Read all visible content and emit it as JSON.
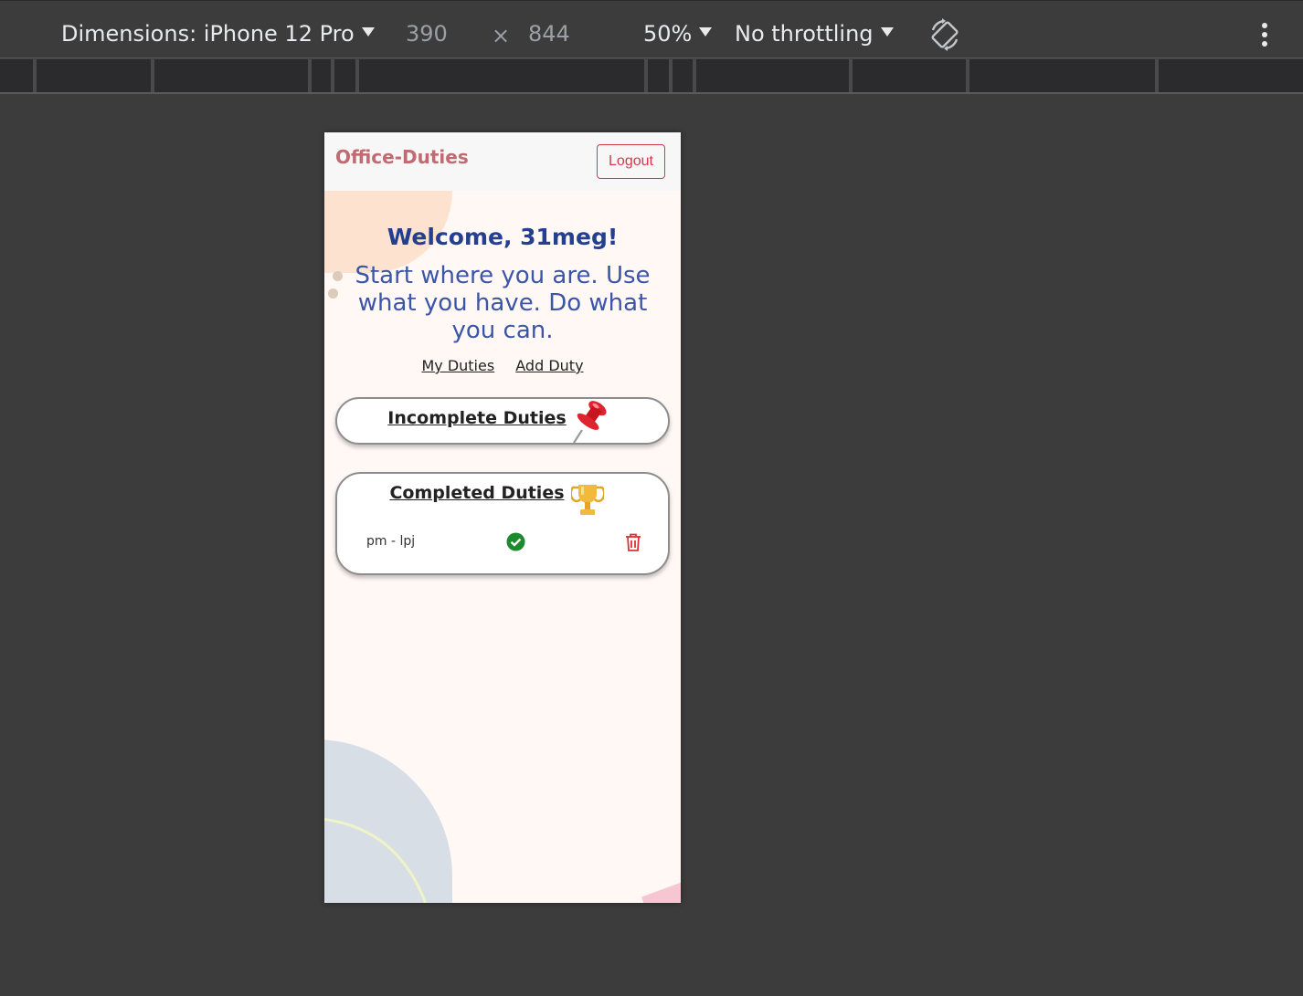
{
  "devtools": {
    "dimensions_label": "Dimensions: iPhone 12 Pro",
    "width": "390",
    "times": "×",
    "height": "844",
    "zoom": "50%",
    "throttling": "No throttling",
    "rotate_icon": "rotate-icon",
    "more_icon": "kebab-menu-icon"
  },
  "app": {
    "brand": "Office-Duties",
    "logout_label": "Logout",
    "welcome": "Welcome, 31meg!",
    "quote": "Start where you are. Use what you have. Do what you can.",
    "nav": {
      "my_duties": "My Duties",
      "add_duty": "Add Duty"
    },
    "incomplete": {
      "title": "Incomplete Duties",
      "icon": "pushpin-icon"
    },
    "completed": {
      "title": "Completed Duties",
      "icon": "trophy-icon",
      "items": [
        {
          "text": "pm - lpj",
          "status_icon": "check-circle-icon",
          "action_icon": "trash-icon"
        }
      ]
    },
    "colors": {
      "brand": "#c06a72",
      "logout": "#d23a4a",
      "heading": "#243f8f",
      "quote": "#3b55a7",
      "check": "#1e8a2e",
      "trash": "#e03131"
    }
  }
}
